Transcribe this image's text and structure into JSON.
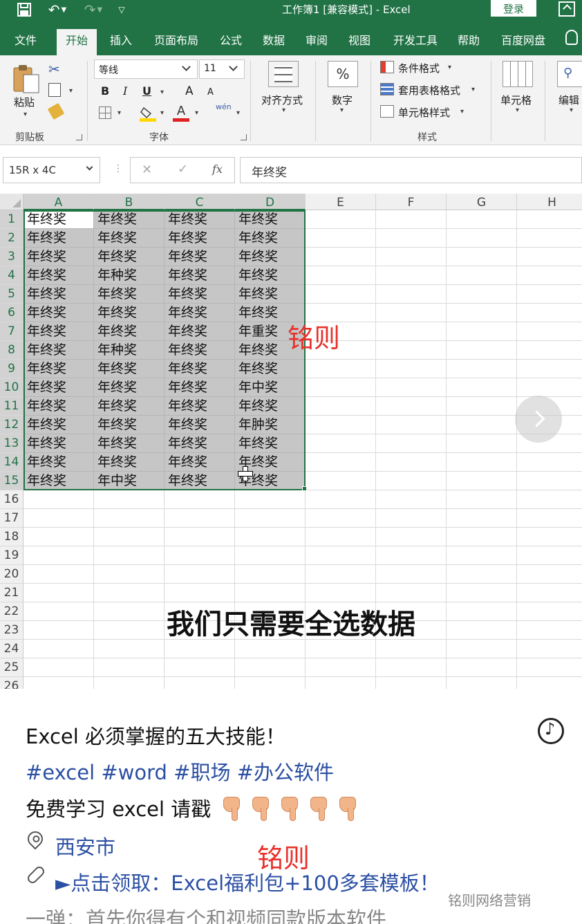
{
  "window": {
    "title": "工作簿1 [兼容模式] - Excel",
    "login": "登录"
  },
  "tabs": [
    "文件",
    "开始",
    "插入",
    "页面布局",
    "公式",
    "数据",
    "审阅",
    "视图",
    "开发工具",
    "帮助",
    "百度网盘"
  ],
  "active_tab": "开始",
  "ribbon": {
    "clipboard": {
      "paste": "粘贴",
      "label": "剪贴板"
    },
    "font": {
      "name": "等线",
      "size": "11",
      "bold": "B",
      "italic": "I",
      "underline": "U",
      "grow": "A",
      "shrink": "A",
      "label": "字体",
      "phonetic": "wén"
    },
    "alignment": {
      "label": "对齐方式"
    },
    "number": {
      "symbol": "%",
      "label": "数字"
    },
    "styles": {
      "conditional": "条件格式",
      "table": "套用表格格式",
      "cell": "单元格样式",
      "label": "样式"
    },
    "cells": {
      "label": "单元格"
    },
    "editing": {
      "label": "编辑"
    }
  },
  "formula_bar": {
    "name_box": "15R x 4C",
    "value": "年终奖"
  },
  "grid": {
    "columns": [
      "A",
      "B",
      "C",
      "D",
      "E",
      "F",
      "G",
      "H"
    ],
    "rows": [
      "1",
      "2",
      "3",
      "4",
      "5",
      "6",
      "7",
      "8",
      "9",
      "10",
      "11",
      "12",
      "13",
      "14",
      "15",
      "16",
      "17",
      "18",
      "19",
      "20",
      "21",
      "22",
      "23",
      "24",
      "25",
      "26"
    ],
    "cells": [
      [
        "年终奖",
        "年终奖",
        "年终奖",
        "年终奖"
      ],
      [
        "年终奖",
        "年终奖",
        "年终奖",
        "年终奖"
      ],
      [
        "年终奖",
        "年终奖",
        "年终奖",
        "年终奖"
      ],
      [
        "年终奖",
        "年种奖",
        "年终奖",
        "年终奖"
      ],
      [
        "年终奖",
        "年终奖",
        "年终奖",
        "年终奖"
      ],
      [
        "年终奖",
        "年终奖",
        "年终奖",
        "年终奖"
      ],
      [
        "年终奖",
        "年终奖",
        "年终奖",
        "年重奖"
      ],
      [
        "年终奖",
        "年种奖",
        "年终奖",
        "年终奖"
      ],
      [
        "年终奖",
        "年终奖",
        "年终奖",
        "年终奖"
      ],
      [
        "年终奖",
        "年终奖",
        "年终奖",
        "年中奖"
      ],
      [
        "年终奖",
        "年终奖",
        "年终奖",
        "年终奖"
      ],
      [
        "年终奖",
        "年终奖",
        "年终奖",
        "年肿奖"
      ],
      [
        "年终奖",
        "年终奖",
        "年终奖",
        "年终奖"
      ],
      [
        "年终奖",
        "年终奖",
        "年终奖",
        "年终奖"
      ],
      [
        "年终奖",
        "年中奖",
        "年终奖",
        "年终奖"
      ]
    ]
  },
  "overlay": {
    "watermark": "铭则",
    "caption": "我们只需要全选数据"
  },
  "post": {
    "title": "Excel 必须掌握的五大技能！",
    "tags": "#excel #word #职场 #办公软件",
    "promo": "免费学习 excel 请戳",
    "location": "西安市",
    "watermark": "铭则",
    "link": "►点击领取：Excel福利包+100多套模板！",
    "comment": "一弹：首先你得有个和视频同款版本软件",
    "brand": "铭则网络营销"
  },
  "colors": {
    "excel_green": "#217346",
    "selection_gray": "#c6c6c6",
    "watermark_red": "#e8312b",
    "link_blue": "#2b4fa3"
  }
}
